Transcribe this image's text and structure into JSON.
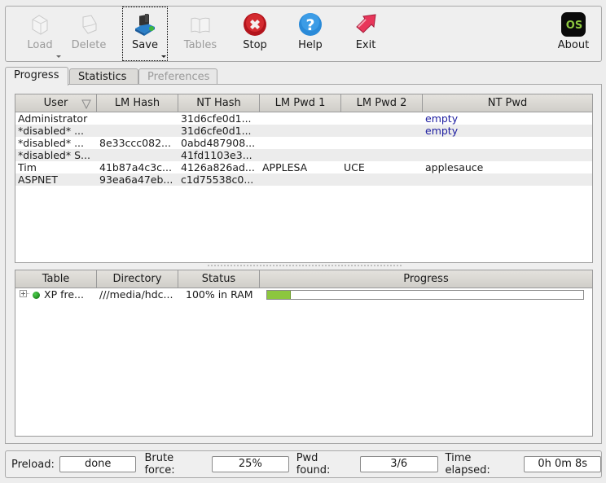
{
  "toolbar": {
    "buttons": [
      {
        "id": "load",
        "label": "Load",
        "icon": "load-icon",
        "enabled": false,
        "has_dropdown": true
      },
      {
        "id": "delete",
        "label": "Delete",
        "icon": "delete-icon",
        "enabled": false
      },
      {
        "id": "save",
        "label": "Save",
        "icon": "save-icon",
        "enabled": true,
        "has_dropdown": true,
        "focused": true
      },
      {
        "id": "tables",
        "label": "Tables",
        "icon": "tables-icon",
        "enabled": false
      },
      {
        "id": "stop",
        "label": "Stop",
        "icon": "stop-icon",
        "enabled": true
      },
      {
        "id": "help",
        "label": "Help",
        "icon": "help-icon",
        "enabled": true
      },
      {
        "id": "exit",
        "label": "Exit",
        "icon": "exit-icon",
        "enabled": true
      },
      {
        "id": "about",
        "label": "About",
        "icon": "about-os-icon",
        "icon_text": "OS",
        "enabled": true
      }
    ]
  },
  "tabs": [
    {
      "label": "Progress",
      "active": true
    },
    {
      "label": "Statistics",
      "active": false
    },
    {
      "label": "Preferences",
      "active": false,
      "disabled": true
    }
  ],
  "users_table": {
    "columns": [
      "User",
      "LM Hash",
      "NT Hash",
      "LM Pwd 1",
      "LM Pwd 2",
      "NT Pwd"
    ],
    "sort_column": "User",
    "rows": [
      {
        "user": "Administrator",
        "lm_hash": "",
        "nt_hash": "31d6cfe0d1...",
        "lm_pwd1": "",
        "lm_pwd2": "",
        "nt_pwd": "empty"
      },
      {
        "user": "*disabled* ...",
        "lm_hash": "",
        "nt_hash": "31d6cfe0d1...",
        "lm_pwd1": "",
        "lm_pwd2": "",
        "nt_pwd": "empty"
      },
      {
        "user": "*disabled* ...",
        "lm_hash": "8e33ccc082...",
        "nt_hash": "0abd487908...",
        "lm_pwd1": "",
        "lm_pwd2": "",
        "nt_pwd": ""
      },
      {
        "user": "*disabled* S...",
        "lm_hash": "",
        "nt_hash": "41fd1103e3...",
        "lm_pwd1": "",
        "lm_pwd2": "",
        "nt_pwd": ""
      },
      {
        "user": "Tim",
        "lm_hash": "41b87a4c3c...",
        "nt_hash": "4126a826ad...",
        "lm_pwd1": "APPLESA",
        "lm_pwd2": "UCE",
        "nt_pwd": "applesauce"
      },
      {
        "user": "ASPNET",
        "lm_hash": "93ea6a47eb...",
        "nt_hash": "c1d75538c0...",
        "lm_pwd1": "",
        "lm_pwd2": "",
        "nt_pwd": ""
      }
    ]
  },
  "tables_table": {
    "columns": [
      "Table",
      "Directory",
      "Status",
      "Progress"
    ],
    "rows": [
      {
        "table": "XP fre...",
        "directory": "///media/hdc...",
        "status": "100% in RAM",
        "progress_percent": 7.5,
        "status_color": "#1a8a1a"
      }
    ]
  },
  "status": {
    "preload_label": "Preload:",
    "preload_value": "done",
    "brute_label": "Brute force:",
    "brute_value": "25%",
    "found_label": "Pwd found:",
    "found_value": "3/6",
    "time_label": "Time elapsed:",
    "time_value": "0h 0m 8s"
  },
  "colors": {
    "cracked_empty": "#1c1ca0",
    "progress_fill": "#8cc63f"
  }
}
